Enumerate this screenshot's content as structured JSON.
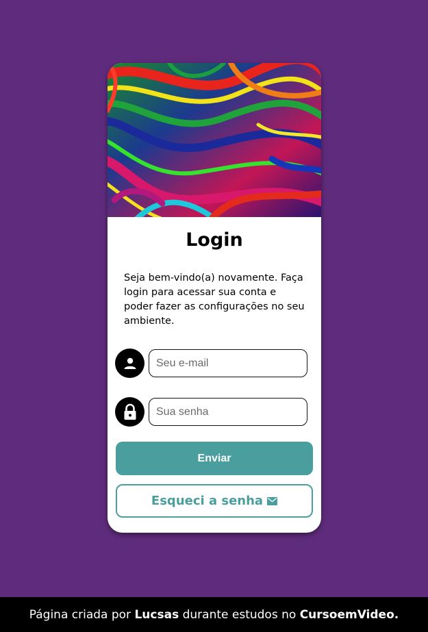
{
  "login": {
    "title": "Login",
    "intro": "Seja bem-vindo(a) novamente. Faça login para acessar sua conta e poder fazer as configurações no seu ambiente.",
    "email": {
      "placeholder": "Seu e-mail",
      "value": "",
      "icon": "person-icon"
    },
    "password": {
      "placeholder": "Sua senha",
      "value": "",
      "icon": "lock-icon"
    },
    "send_label": "Enviar",
    "forgot_label": "Esqueci a senha",
    "forgot_icon": "mail-icon"
  },
  "footer": {
    "prefix": "Página criada por",
    "author": "Lucsas",
    "middle": "durante estudos no",
    "course": "CursoemVideo."
  },
  "colors": {
    "background": "#5f2c7d",
    "accent": "#4a9e9e",
    "footer": "#000000"
  }
}
